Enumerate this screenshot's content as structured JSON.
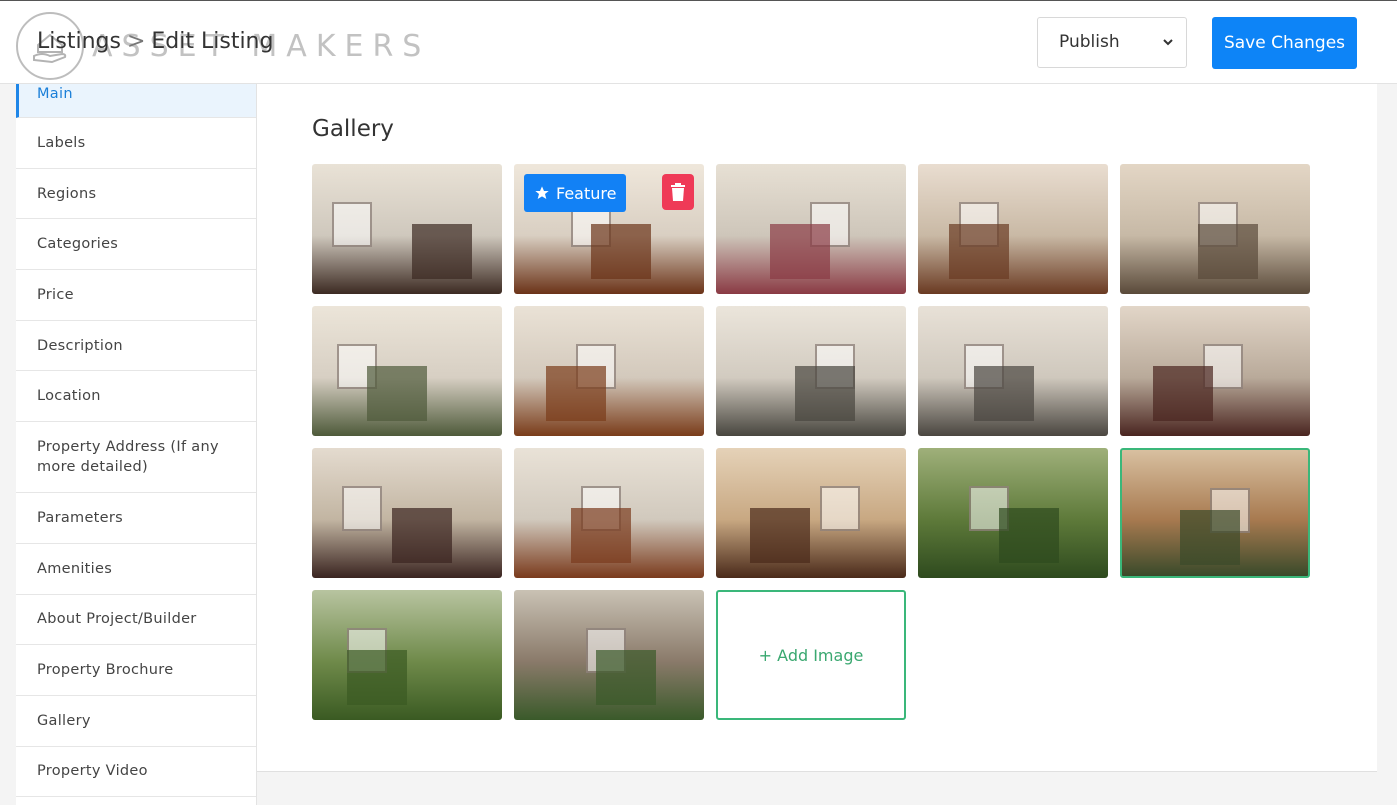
{
  "header": {
    "breadcrumb_parent": "Listings",
    "breadcrumb_separator": ">",
    "breadcrumb_current": "Edit Listing",
    "logo_text": "ASSET MAKERS",
    "status_select": {
      "selected": "Publish"
    },
    "save_label": "Save Changes"
  },
  "sidebar": {
    "items": [
      {
        "label": "Main",
        "active": true
      },
      {
        "label": "Labels"
      },
      {
        "label": "Regions"
      },
      {
        "label": "Categories"
      },
      {
        "label": "Price"
      },
      {
        "label": "Description"
      },
      {
        "label": "Location"
      },
      {
        "label": "Property Address (If any more detailed)"
      },
      {
        "label": "Parameters"
      },
      {
        "label": "Amenities"
      },
      {
        "label": "About Project/Builder"
      },
      {
        "label": "Property Brochure"
      },
      {
        "label": "Gallery"
      },
      {
        "label": "Property Video"
      }
    ]
  },
  "gallery": {
    "title": "Gallery",
    "feature_label": "Feature",
    "add_label": "+ Add Image",
    "images": [
      {
        "scene": "living-room"
      },
      {
        "scene": "bedroom-wardrobe",
        "hover": true
      },
      {
        "scene": "living-room-curtains"
      },
      {
        "scene": "kitchen"
      },
      {
        "scene": "bunk-room"
      },
      {
        "scene": "dining"
      },
      {
        "scene": "wardrobe"
      },
      {
        "scene": "bedroom"
      },
      {
        "scene": "bedroom-2"
      },
      {
        "scene": "room-dark"
      },
      {
        "scene": "bathroom"
      },
      {
        "scene": "bedroom-3"
      },
      {
        "scene": "bathroom-2"
      },
      {
        "scene": "garden-view"
      },
      {
        "scene": "balcony",
        "selected": true
      },
      {
        "scene": "garden-palm"
      },
      {
        "scene": "backyard"
      }
    ]
  },
  "colors": {
    "accent": "#0d84f7",
    "success": "#3ab77a",
    "danger": "#ef3a57"
  }
}
